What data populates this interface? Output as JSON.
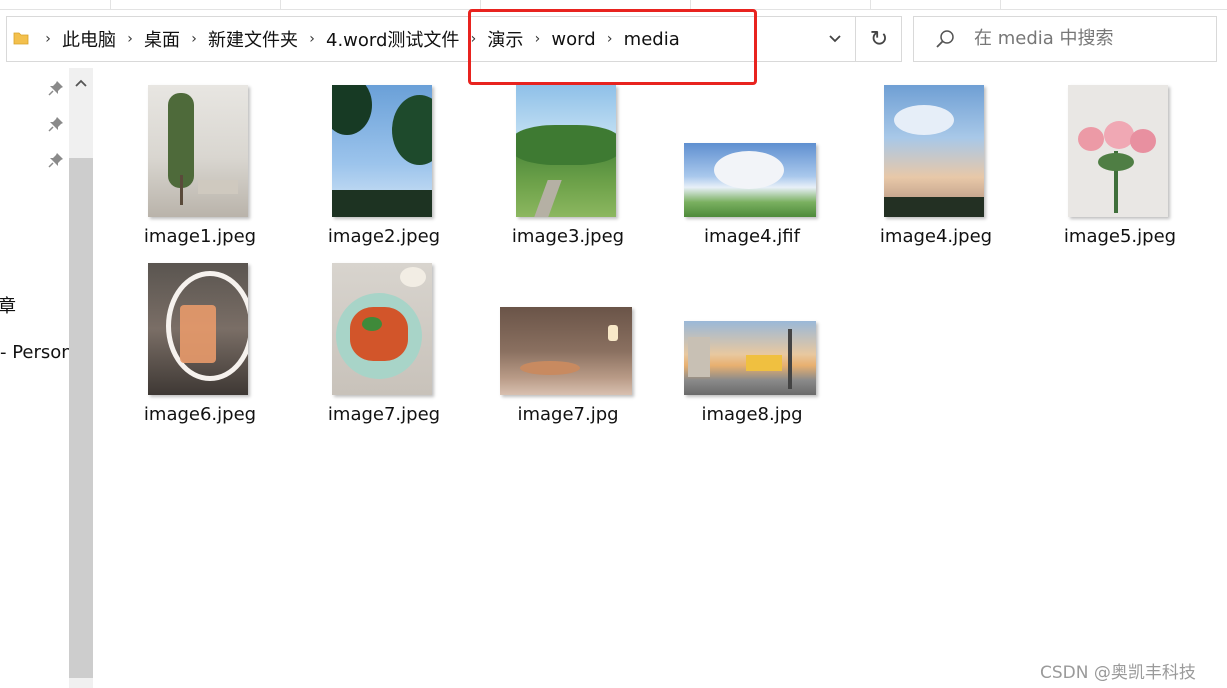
{
  "address_bar": {
    "crumbs": [
      "此电脑",
      "桌面",
      "新建文件夹",
      "4.word测试文件",
      "演示",
      "word",
      "media"
    ]
  },
  "search": {
    "placeholder": "在 media 中搜索"
  },
  "nav": {
    "partial_items": [
      "章",
      "- Person"
    ]
  },
  "files": [
    {
      "name": "image1.jpeg"
    },
    {
      "name": "image2.jpeg"
    },
    {
      "name": "image3.jpeg"
    },
    {
      "name": "image4.jfif"
    },
    {
      "name": "image4.jpeg"
    },
    {
      "name": "image5.jpeg"
    },
    {
      "name": "image6.jpeg"
    },
    {
      "name": "image7.jpeg"
    },
    {
      "name": "image7.jpg"
    },
    {
      "name": "image8.jpg"
    }
  ],
  "watermark": "CSDN @奥凯丰科技",
  "colors": {
    "highlight": "#e8231f",
    "folder": "#f3c04d"
  }
}
